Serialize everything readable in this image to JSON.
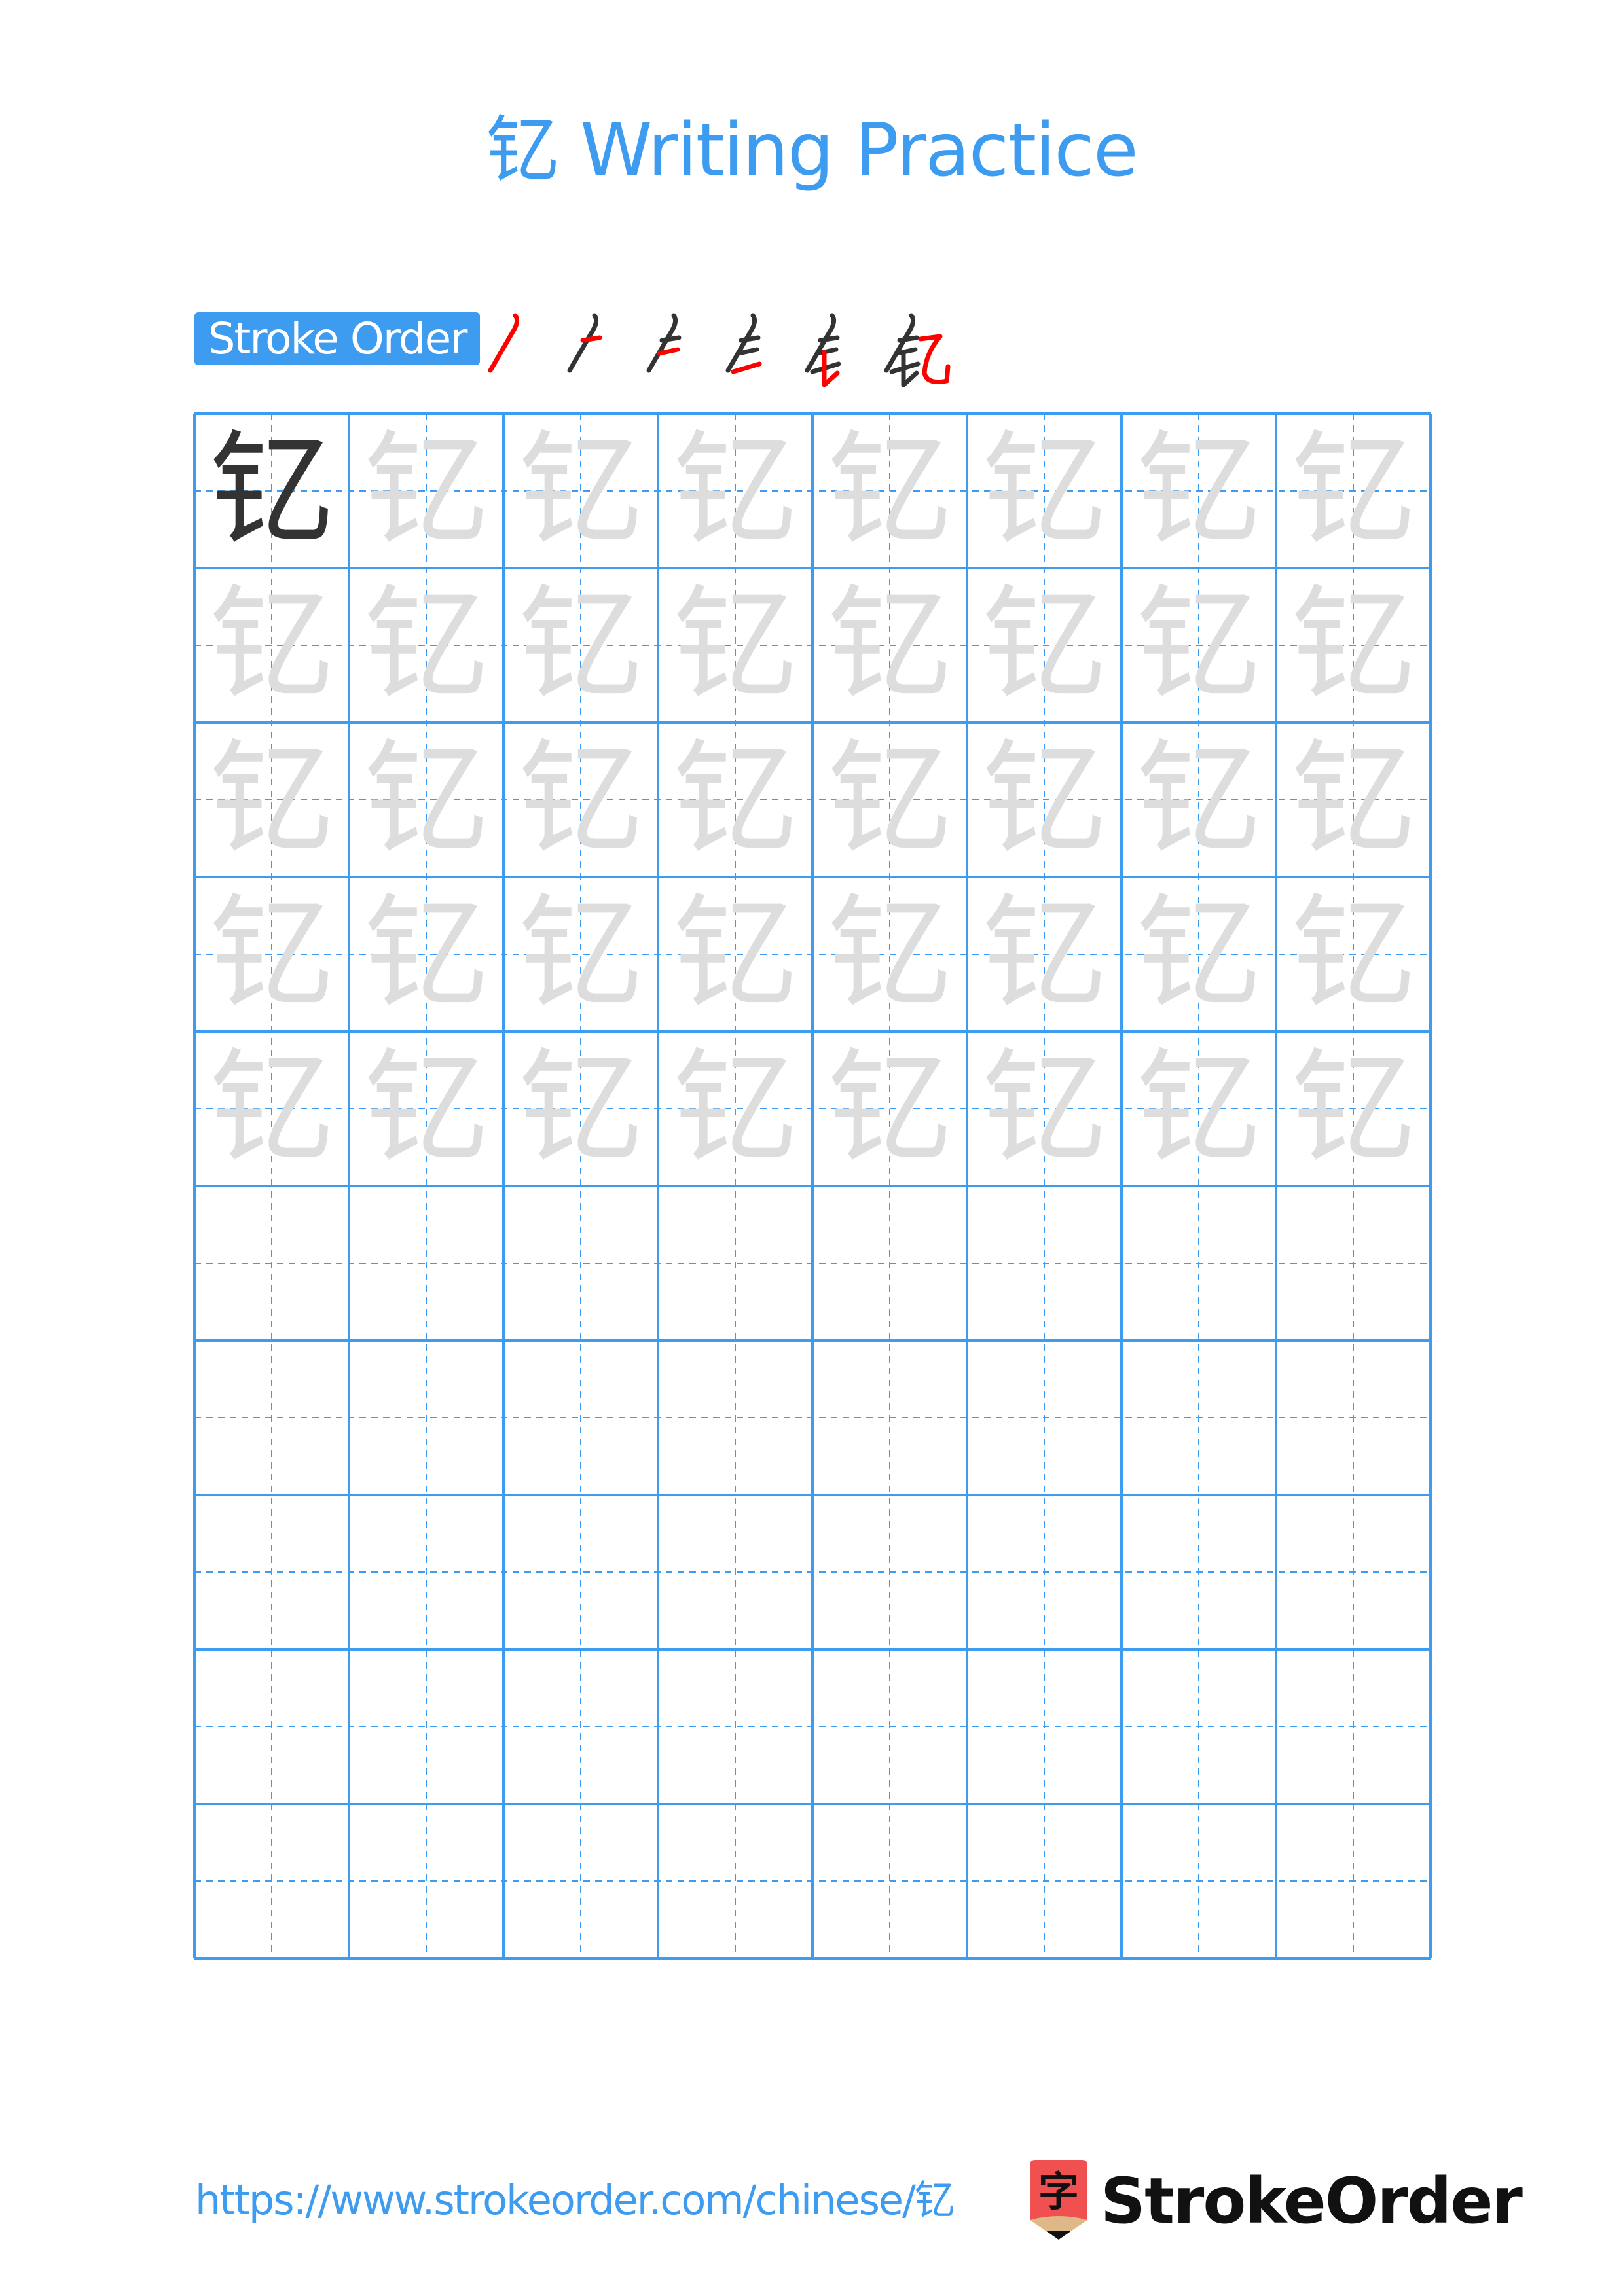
{
  "page": {
    "title": "钇 Writing Practice",
    "character": "钇"
  },
  "stroke_order": {
    "label": "Stroke Order",
    "steps": [
      {
        "index": 1,
        "description": "piě (left-falling)"
      },
      {
        "index": 2,
        "description": "horizontal"
      },
      {
        "index": 3,
        "description": "horizontal"
      },
      {
        "index": 4,
        "description": "rising horizontal"
      },
      {
        "index": 5,
        "description": "vertical-hook"
      },
      {
        "index": 6,
        "description": "horizontal-slant-hook 乙"
      }
    ],
    "step_count": 6
  },
  "practice_grid": {
    "columns": 8,
    "rows": 10,
    "model_cells": 1,
    "traced_rows": 5,
    "empty_rows": 5
  },
  "colors": {
    "accent": "#3d9bf0",
    "grid_line": "#3d9bf0",
    "model_char": "#333333",
    "trace_char": "#dddddd",
    "stroke_current": "#ff0000",
    "stroke_done": "#333333",
    "logo_red": "#f05050",
    "logo_tan": "#deb887"
  },
  "footer": {
    "url": "https://www.strokeorder.com/chinese/钇",
    "logo_text": "StrokeOrder",
    "logo_icon_char": "字"
  }
}
